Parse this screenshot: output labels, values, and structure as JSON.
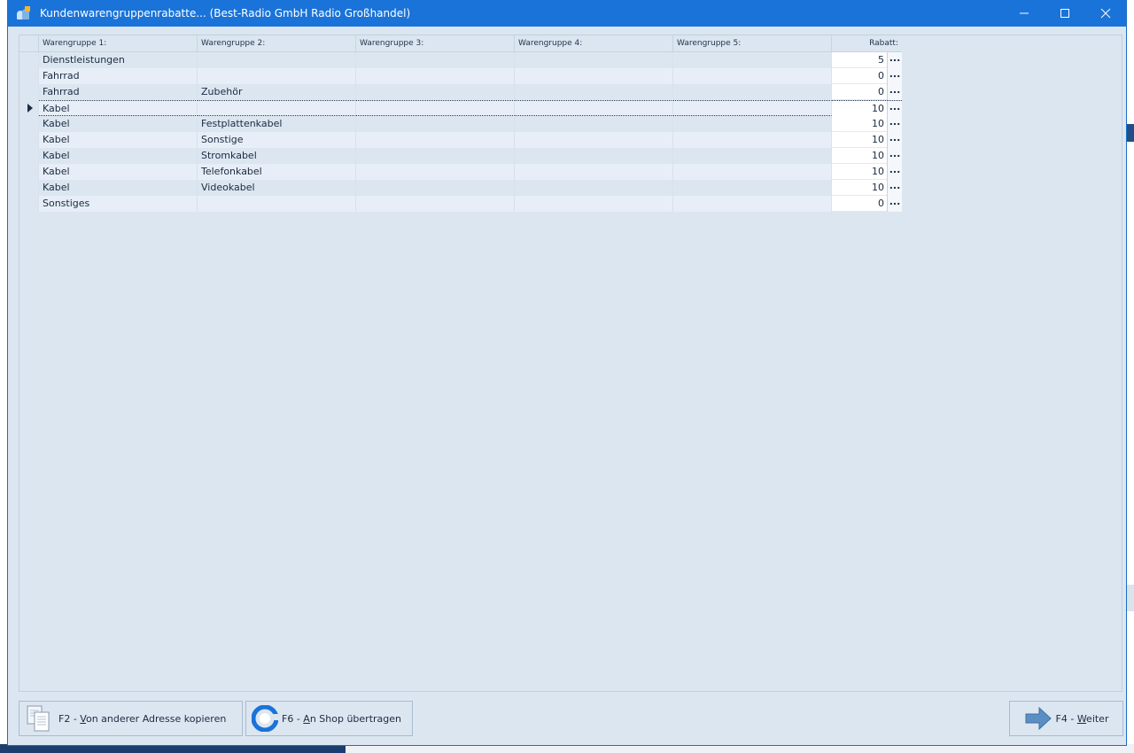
{
  "window": {
    "title": "Kundenwarengruppenrabatte... (Best-Radio GmbH Radio Großhandel)"
  },
  "grid": {
    "columns": [
      "Warengruppe 1:",
      "Warengruppe 2:",
      "Warengruppe 3:",
      "Warengruppe 4:",
      "Warengruppe 5:",
      "Rabatt:"
    ],
    "selected_row_index": 3,
    "rows": [
      {
        "wg1": "Dienstleistungen",
        "wg2": "",
        "wg3": "",
        "wg4": "",
        "wg5": "",
        "rabatt": "5"
      },
      {
        "wg1": "Fahrrad",
        "wg2": "",
        "wg3": "",
        "wg4": "",
        "wg5": "",
        "rabatt": "0"
      },
      {
        "wg1": "Fahrrad",
        "wg2": "Zubehör",
        "wg3": "",
        "wg4": "",
        "wg5": "",
        "rabatt": "0"
      },
      {
        "wg1": "Kabel",
        "wg2": "",
        "wg3": "",
        "wg4": "",
        "wg5": "",
        "rabatt": "10"
      },
      {
        "wg1": "Kabel",
        "wg2": "Festplattenkabel",
        "wg3": "",
        "wg4": "",
        "wg5": "",
        "rabatt": "10"
      },
      {
        "wg1": "Kabel",
        "wg2": "Sonstige",
        "wg3": "",
        "wg4": "",
        "wg5": "",
        "rabatt": "10"
      },
      {
        "wg1": "Kabel",
        "wg2": "Stromkabel",
        "wg3": "",
        "wg4": "",
        "wg5": "",
        "rabatt": "10"
      },
      {
        "wg1": "Kabel",
        "wg2": "Telefonkabel",
        "wg3": "",
        "wg4": "",
        "wg5": "",
        "rabatt": "10"
      },
      {
        "wg1": "Kabel",
        "wg2": "Videokabel",
        "wg3": "",
        "wg4": "",
        "wg5": "",
        "rabatt": "10"
      },
      {
        "wg1": "Sonstiges",
        "wg2": "",
        "wg3": "",
        "wg4": "",
        "wg5": "",
        "rabatt": "0"
      }
    ],
    "ellipsis": "..."
  },
  "buttons": {
    "copy": {
      "prefix": "F2 - ",
      "hotkey": "V",
      "rest": "on anderer Adresse kopieren"
    },
    "shop": {
      "prefix": "F6 - ",
      "hotkey": "A",
      "rest": "n Shop übertragen"
    },
    "next": {
      "prefix": "F4 - ",
      "hotkey": "W",
      "rest": "eiter"
    }
  },
  "colors": {
    "titlebar": "#1a73d9",
    "window_bg": "#dce6f1",
    "row_alt": "#e7eef7"
  }
}
